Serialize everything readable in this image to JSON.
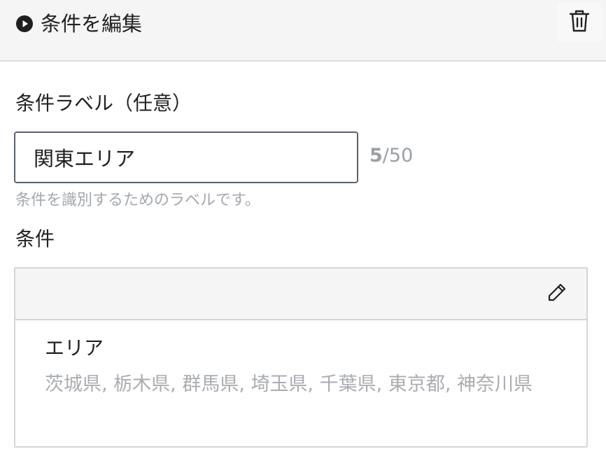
{
  "header": {
    "title": "条件を編集",
    "icons": {
      "leading": "play-circle-icon",
      "action": "trash-icon"
    }
  },
  "label_field": {
    "label": "条件ラベル（任意）",
    "value": "関東エリア",
    "counter_current": "5",
    "counter_max": "/50",
    "help": "条件を識別するためのラベルです。"
  },
  "conditions": {
    "label": "条件",
    "edit_icon": "pencil-icon",
    "item": {
      "name": "エリア",
      "values": "茨城県, 栃木県, 群馬県, 埼玉県, 千葉県, 東京都, 神奈川県"
    }
  },
  "colors": {
    "header_bg": "#f5f5f5",
    "input_border": "#5b6270",
    "muted_text": "#a4a8ad"
  }
}
